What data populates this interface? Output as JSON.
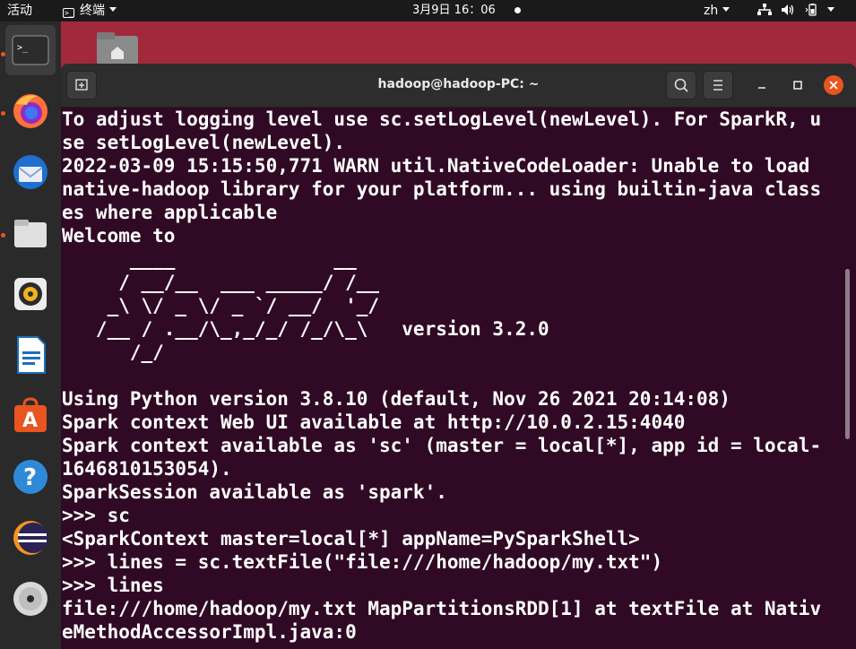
{
  "topbar": {
    "activities": "活动",
    "app_menu": "终端",
    "clock": "3月9日  16：06",
    "language": "zh"
  },
  "dock": {
    "items": [
      {
        "name": "terminal",
        "active": true
      },
      {
        "name": "firefox"
      },
      {
        "name": "thunderbird"
      },
      {
        "name": "files"
      },
      {
        "name": "rhythmbox"
      },
      {
        "name": "libreoffice-writer"
      },
      {
        "name": "ubuntu-software"
      },
      {
        "name": "help"
      },
      {
        "name": "eclipse"
      },
      {
        "name": "dvd-drive"
      }
    ],
    "accent": "#e95420"
  },
  "window": {
    "title": "hadoop@hadoop-PC: ~",
    "background": "#300a24"
  },
  "terminal": {
    "lines": [
      "To adjust logging level use sc.setLogLevel(newLevel). For SparkR, u",
      "se setLogLevel(newLevel).",
      "2022-03-09 15:15:50,771 WARN util.NativeCodeLoader: Unable to load",
      "native-hadoop library for your platform... using builtin-java class",
      "es where applicable",
      "Welcome to",
      "      ____              __",
      "     / __/__  ___ _____/ /__",
      "    _\\ \\/ _ \\/ _ `/ __/  '_/",
      "   /__ / .__/\\_,_/_/ /_/\\_\\   version 3.2.0",
      "      /_/",
      "",
      "Using Python version 3.8.10 (default, Nov 26 2021 20:14:08)",
      "Spark context Web UI available at http://10.0.2.15:4040",
      "Spark context available as 'sc' (master = local[*], app id = local-",
      "1646810153054).",
      "SparkSession available as 'spark'.",
      ">>> sc",
      "<SparkContext master=local[*] appName=PySparkShell>",
      ">>> lines = sc.textFile(\"file:///home/hadoop/my.txt\")",
      ">>> lines",
      "file:///home/hadoop/my.txt MapPartitionsRDD[1] at textFile at Nativ",
      "eMethodAccessorImpl.java:0"
    ]
  }
}
